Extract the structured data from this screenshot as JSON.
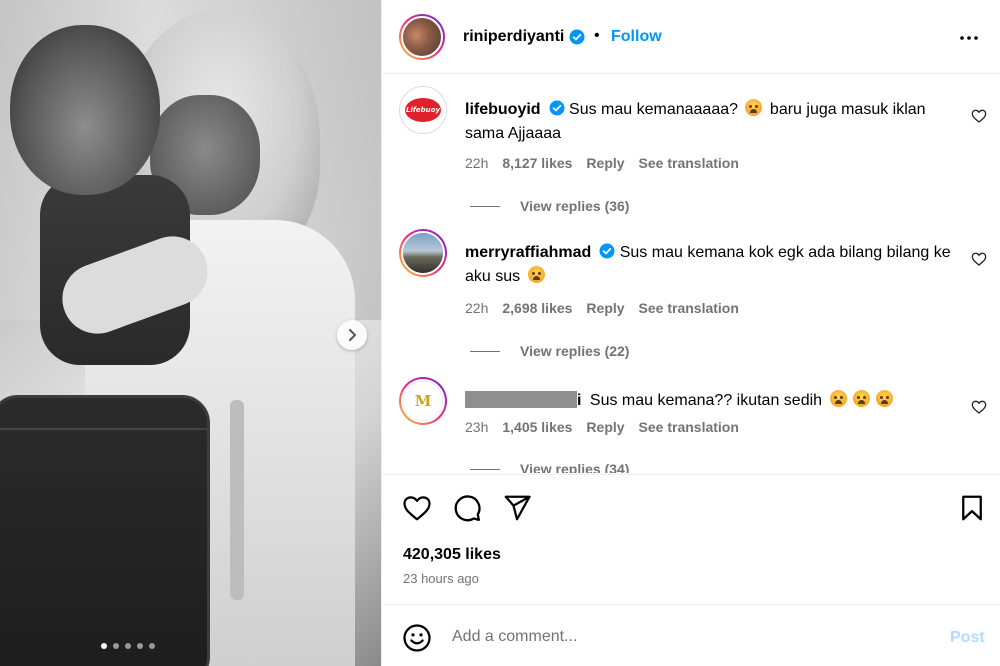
{
  "post": {
    "owner": "riniperdiyanti",
    "follow_label": "Follow",
    "bullet": "•",
    "likes": "420,305 likes",
    "time_ago": "23 hours ago",
    "carousel": {
      "slides": 5,
      "active_index": 0
    }
  },
  "comments": [
    {
      "username": "lifebuoyid",
      "verified": true,
      "text_a": "Sus mau kemanaaaaa?",
      "text_b": "baru juga masuk iklan sama Ajjaaaa",
      "time": "22h",
      "likes": "8,127 likes",
      "reply_label": "Reply",
      "translate_label": "See translation",
      "view_replies": "View replies (36)",
      "avatar_logo_text": "Lifebuoy"
    },
    {
      "username": "merryraffiahmad",
      "verified": true,
      "text_a": "Sus mau kemana kok egk ada bilang bilang ke aku sus",
      "time": "22h",
      "likes": "2,698 likes",
      "reply_label": "Reply",
      "translate_label": "See translation",
      "view_replies": "View replies (22)"
    },
    {
      "username_tail": "i",
      "text_a": "Sus mau kemana?? ikutan sedih",
      "time": "23h",
      "likes": "1,405 likes",
      "reply_label": "Reply",
      "translate_label": "See translation",
      "view_replies": "View replies (34)",
      "avatar_logo_text": "M"
    }
  ],
  "composer": {
    "placeholder": "Add a comment...",
    "post_label": "Post"
  },
  "icons": {
    "verified": "verified-badge-icon",
    "more": "more-options-icon",
    "heart": "heart-icon",
    "comment": "comment-icon",
    "share": "share-icon",
    "save": "bookmark-icon",
    "emoji": "emoji-icon",
    "next": "chevron-right-icon"
  },
  "colors": {
    "accent": "#0095f6",
    "verified": "#0095f6",
    "post_disabled": "#b3dbff",
    "muted": "#737373"
  }
}
